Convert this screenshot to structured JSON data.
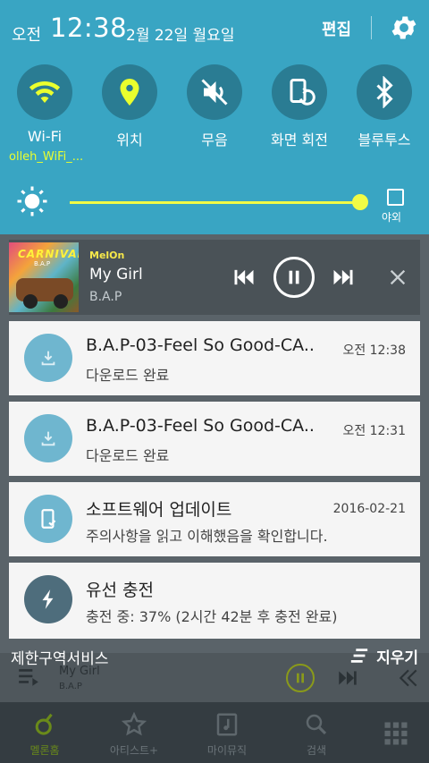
{
  "status": {
    "ampm": "오전",
    "time": "12:38",
    "date": "2월 22일 월요일",
    "edit_label": "편집"
  },
  "quick_settings": [
    {
      "label": "Wi-Fi",
      "icon": "wifi-icon",
      "active": true,
      "sub": "olleh_WiFi_..."
    },
    {
      "label": "위치",
      "icon": "location-pin-icon",
      "active": true
    },
    {
      "label": "무음",
      "icon": "mute-icon",
      "active": false
    },
    {
      "label": "화면 회전",
      "icon": "screen-rotation-icon",
      "active": false
    },
    {
      "label": "블루투스",
      "icon": "bluetooth-icon",
      "active": false
    }
  ],
  "brightness": {
    "level": 0.99,
    "outdoor_label": "야외"
  },
  "media": {
    "app": "MelOn",
    "title": "My Girl",
    "artist": "B.A.P",
    "album_art_text": "CARNIVAL",
    "album_art_sub": "B.A.P"
  },
  "notifications": [
    {
      "title": "B.A.P-03-Feel So Good-CA..",
      "text": "다운로드 완료",
      "time": "오전 12:38",
      "icon": "download-icon"
    },
    {
      "title": "B.A.P-03-Feel So Good-CA..",
      "text": "다운로드 완료",
      "time": "오전 12:31",
      "icon": "download-icon"
    },
    {
      "title": "소프트웨어 업데이트",
      "text": "주의사항을 읽고 이해했음을 확인합니다.",
      "time": "2016-02-21",
      "icon": "phone-update-icon"
    },
    {
      "title": "유선 충전",
      "text": "충전 중: 37% (2시간 42분 후 충전 완료)",
      "time": "",
      "icon": "lightning-icon"
    }
  ],
  "limit_service": "제한구역서비스",
  "clear_label": "지우기",
  "background_app": {
    "player_title": "My Girl",
    "player_artist": "B.A.P",
    "nav": [
      "멜론홈",
      "아티스트+",
      "마이뮤직",
      "검색"
    ]
  },
  "colors": {
    "panel": "#39a5c3",
    "active_yellow": "#eaff2e",
    "card": "#f5f5f5",
    "icon_blue": "#6fb6cf",
    "icon_dark": "#4e6d7c"
  }
}
